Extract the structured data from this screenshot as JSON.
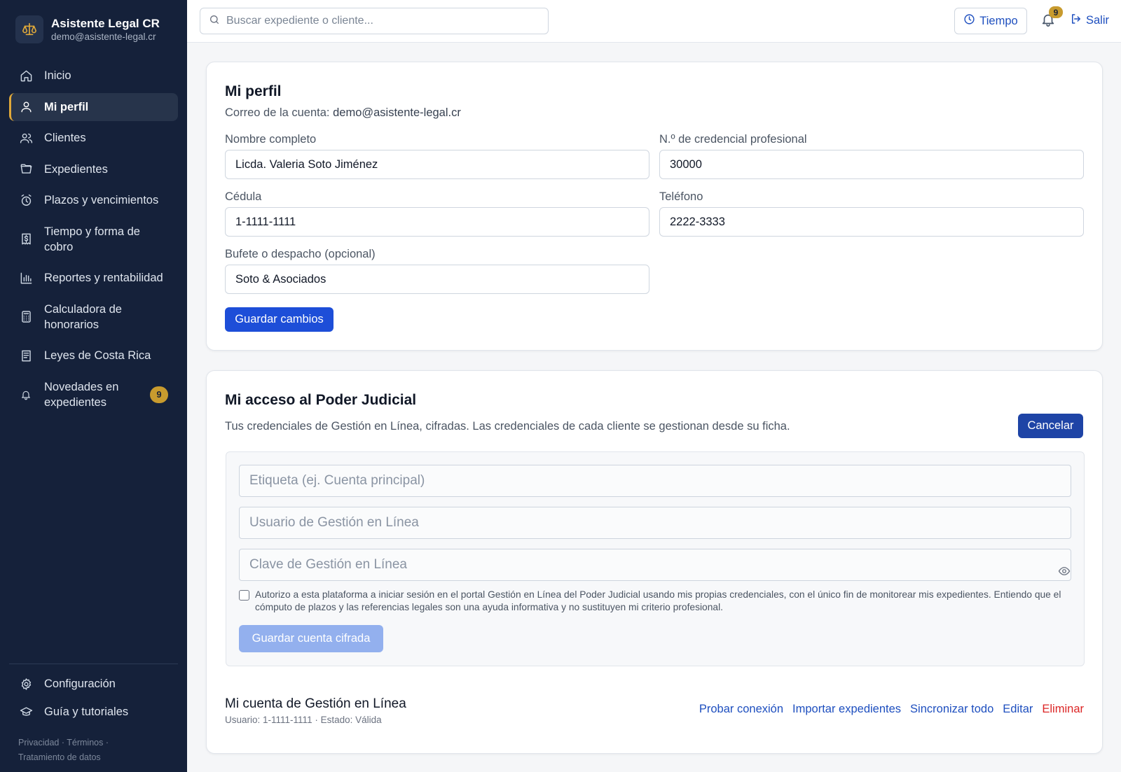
{
  "brand": {
    "name": "Asistente Legal CR",
    "email": "demo@asistente-legal.cr",
    "logo_icon": "scales-icon",
    "accent_color": "#e0a93a"
  },
  "sidebar": {
    "items": [
      {
        "label": "Inicio",
        "icon": "home-icon"
      },
      {
        "label": "Mi perfil",
        "icon": "user-icon",
        "active": true
      },
      {
        "label": "Clientes",
        "icon": "users-icon"
      },
      {
        "label": "Expedientes",
        "icon": "folder-icon"
      },
      {
        "label": "Plazos y vencimientos",
        "icon": "alarm-clock-icon"
      },
      {
        "label": "Tiempo y forma de cobro",
        "icon": "receipt-icon"
      },
      {
        "label": "Reportes y rentabilidad",
        "icon": "bar-chart-icon"
      },
      {
        "label": "Calculadora de honorarios",
        "icon": "calculator-icon"
      },
      {
        "label": "Leyes de Costa Rica",
        "icon": "book-icon"
      },
      {
        "label": "Novedades en expedientes",
        "icon": "bell-icon",
        "badge": "9"
      }
    ],
    "bottom": [
      {
        "label": "Configuración",
        "icon": "gear-icon"
      },
      {
        "label": "Guía y tutoriales",
        "icon": "graduation-cap-icon"
      }
    ],
    "legal": {
      "privacy": "Privacidad",
      "sep1": " · ",
      "terms": "Términos",
      "sep2": " · ",
      "data": "Tratamiento de datos"
    }
  },
  "topbar": {
    "search_placeholder": "Buscar expediente o cliente...",
    "tiempo_label": "Tiempo",
    "notification_count": "9",
    "logout_label": "Salir",
    "link_color": "#1e4fbf"
  },
  "profile": {
    "title": "Mi perfil",
    "account_label": "Correo de la cuenta:",
    "account_email": "demo@asistente-legal.cr",
    "fields": {
      "nombre": {
        "label": "Nombre completo",
        "value": "Licda. Valeria Soto Jiménez"
      },
      "credencial": {
        "label": "N.º de credencial profesional",
        "value": "30000"
      },
      "cedula": {
        "label": "Cédula",
        "value": "1-1111-1111"
      },
      "telefono": {
        "label": "Teléfono",
        "value": "2222-3333"
      },
      "bufete": {
        "label": "Bufete o despacho (opcional)",
        "value": "Soto & Asociados"
      }
    },
    "save_label": "Guardar cambios",
    "primary_color": "#1d4ed8"
  },
  "judicial": {
    "title": "Mi acceso al Poder Judicial",
    "description": "Tus credenciales de Gestión en Línea, cifradas. Las credenciales de cada cliente se gestionan desde su ficha.",
    "cancel_label": "Cancelar",
    "label_placeholder": "Etiqueta (ej. Cuenta principal)",
    "user_placeholder": "Usuario de Gestión en Línea",
    "password_placeholder": "Clave de Gestión en Línea",
    "consent_text": "Autorizo a esta plataforma a iniciar sesión en el portal Gestión en Línea del Poder Judicial usando mis propias credenciales, con el único fin de monitorear mis expedientes. Entiendo que el cómputo de plazos y las referencias legales son una ayuda informativa y no sustituyen mi criterio profesional.",
    "save_encrypted_label": "Guardar cuenta cifrada",
    "account": {
      "title": "Mi cuenta de Gestión en Línea",
      "subtitle": "Usuario: 1-1111-1111 · Estado: Válida"
    },
    "actions": {
      "test": "Probar conexión",
      "import": "Importar expedientes",
      "sync": "Sincronizar todo",
      "edit": "Editar",
      "delete": "Eliminar"
    },
    "danger_color": "#dc2626"
  }
}
